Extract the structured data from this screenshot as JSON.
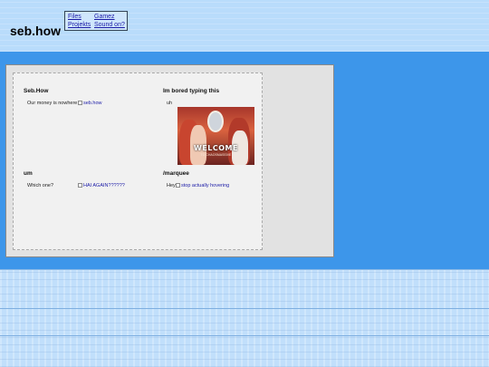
{
  "site": {
    "title": "seb.how"
  },
  "nav": {
    "files": "Files",
    "gamez": "Gamez",
    "projekts": "Projekts",
    "sound": "Sound on?"
  },
  "sections": [
    {
      "heading": "Seb.How",
      "text": "Our money is nowhere",
      "image_alt": "seb.how"
    },
    {
      "heading": "Im bored typing this",
      "text": "uh",
      "image_caption": "WELCOME",
      "image_subcaption": "TO CHAOSMASSIVE"
    },
    {
      "heading": "um",
      "text": "Which one?",
      "image_alt": "HAI AGAIN??????"
    },
    {
      "heading": "/marquee",
      "text": "Hey!",
      "image_alt": "stop actually hovering"
    }
  ],
  "colors": {
    "page_bg": "#3d96ea",
    "header_bg": "#b9dcfb",
    "link": "#1a1aa6",
    "panel_bg": "#e2e2e2"
  }
}
